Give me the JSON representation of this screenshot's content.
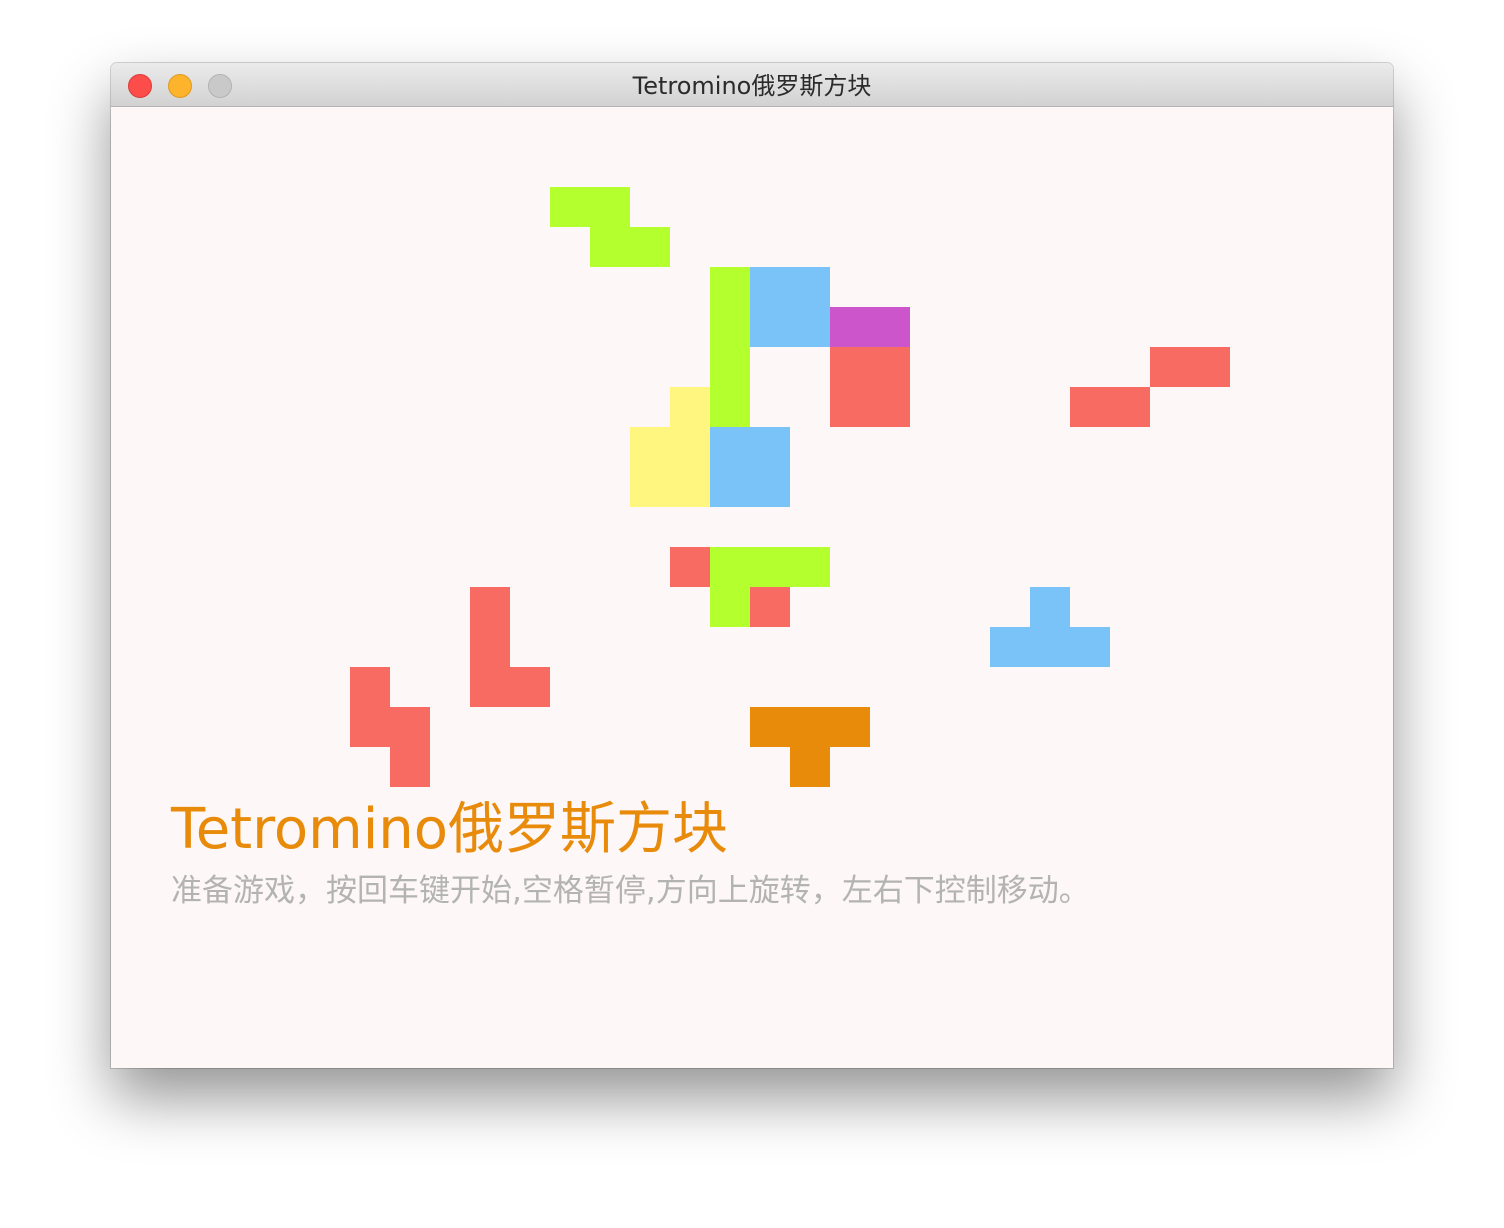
{
  "window": {
    "title": "Tetromino俄罗斯方块"
  },
  "content": {
    "title": "Tetromino俄罗斯方块",
    "instructions": "准备游戏，按回车键开始,空格暂停,方向上旋转，左右下控制移动。",
    "colors": {
      "background": "#fdf7f7",
      "title": "#e88a0a",
      "instructions": "#b3b3b3"
    }
  },
  "board": {
    "colors": {
      "green": "#b4ff2e",
      "blue": "#79c3f8",
      "magenta": "#cc55cc",
      "red": "#f86b62",
      "yellow": "#fff680",
      "orange": "#e88a0a"
    },
    "grid": {
      "columns": 32,
      "rows": 17
    },
    "pieces": [
      {
        "color": "green",
        "cells": [
          [
            11,
            2
          ],
          [
            12,
            2
          ],
          [
            12,
            3
          ],
          [
            13,
            3
          ]
        ]
      },
      {
        "color": "green",
        "cells": [
          [
            15,
            4
          ],
          [
            15,
            5
          ],
          [
            15,
            6
          ],
          [
            15,
            7
          ]
        ]
      },
      {
        "color": "blue",
        "cells": [
          [
            16,
            4
          ],
          [
            17,
            4
          ],
          [
            16,
            5
          ],
          [
            17,
            5
          ]
        ]
      },
      {
        "color": "magenta",
        "cells": [
          [
            18,
            5
          ],
          [
            19,
            5
          ]
        ]
      },
      {
        "color": "red",
        "cells": [
          [
            18,
            6
          ],
          [
            19,
            6
          ],
          [
            18,
            7
          ],
          [
            19,
            7
          ]
        ]
      },
      {
        "color": "red",
        "cells": [
          [
            26,
            6
          ],
          [
            27,
            6
          ],
          [
            24,
            7
          ],
          [
            25,
            7
          ]
        ]
      },
      {
        "color": "yellow",
        "cells": [
          [
            14,
            7
          ],
          [
            13,
            8
          ],
          [
            14,
            8
          ],
          [
            13,
            9
          ],
          [
            14,
            9
          ]
        ]
      },
      {
        "color": "blue",
        "cells": [
          [
            15,
            8
          ],
          [
            16,
            8
          ],
          [
            15,
            9
          ],
          [
            16,
            9
          ]
        ]
      },
      {
        "color": "red",
        "cells": [
          [
            14,
            11
          ],
          [
            16,
            12
          ]
        ]
      },
      {
        "color": "green",
        "cells": [
          [
            15,
            11
          ],
          [
            16,
            11
          ],
          [
            17,
            11
          ],
          [
            15,
            12
          ]
        ]
      },
      {
        "color": "red",
        "cells": [
          [
            9,
            12
          ],
          [
            9,
            13
          ],
          [
            9,
            14
          ],
          [
            10,
            14
          ]
        ]
      },
      {
        "color": "blue",
        "cells": [
          [
            23,
            12
          ],
          [
            22,
            13
          ],
          [
            23,
            13
          ],
          [
            24,
            13
          ]
        ]
      },
      {
        "color": "red",
        "cells": [
          [
            6,
            14
          ],
          [
            6,
            15
          ],
          [
            7,
            15
          ],
          [
            7,
            16
          ]
        ]
      },
      {
        "color": "orange",
        "cells": [
          [
            16,
            15
          ],
          [
            17,
            15
          ],
          [
            18,
            15
          ],
          [
            17,
            16
          ]
        ]
      }
    ]
  }
}
